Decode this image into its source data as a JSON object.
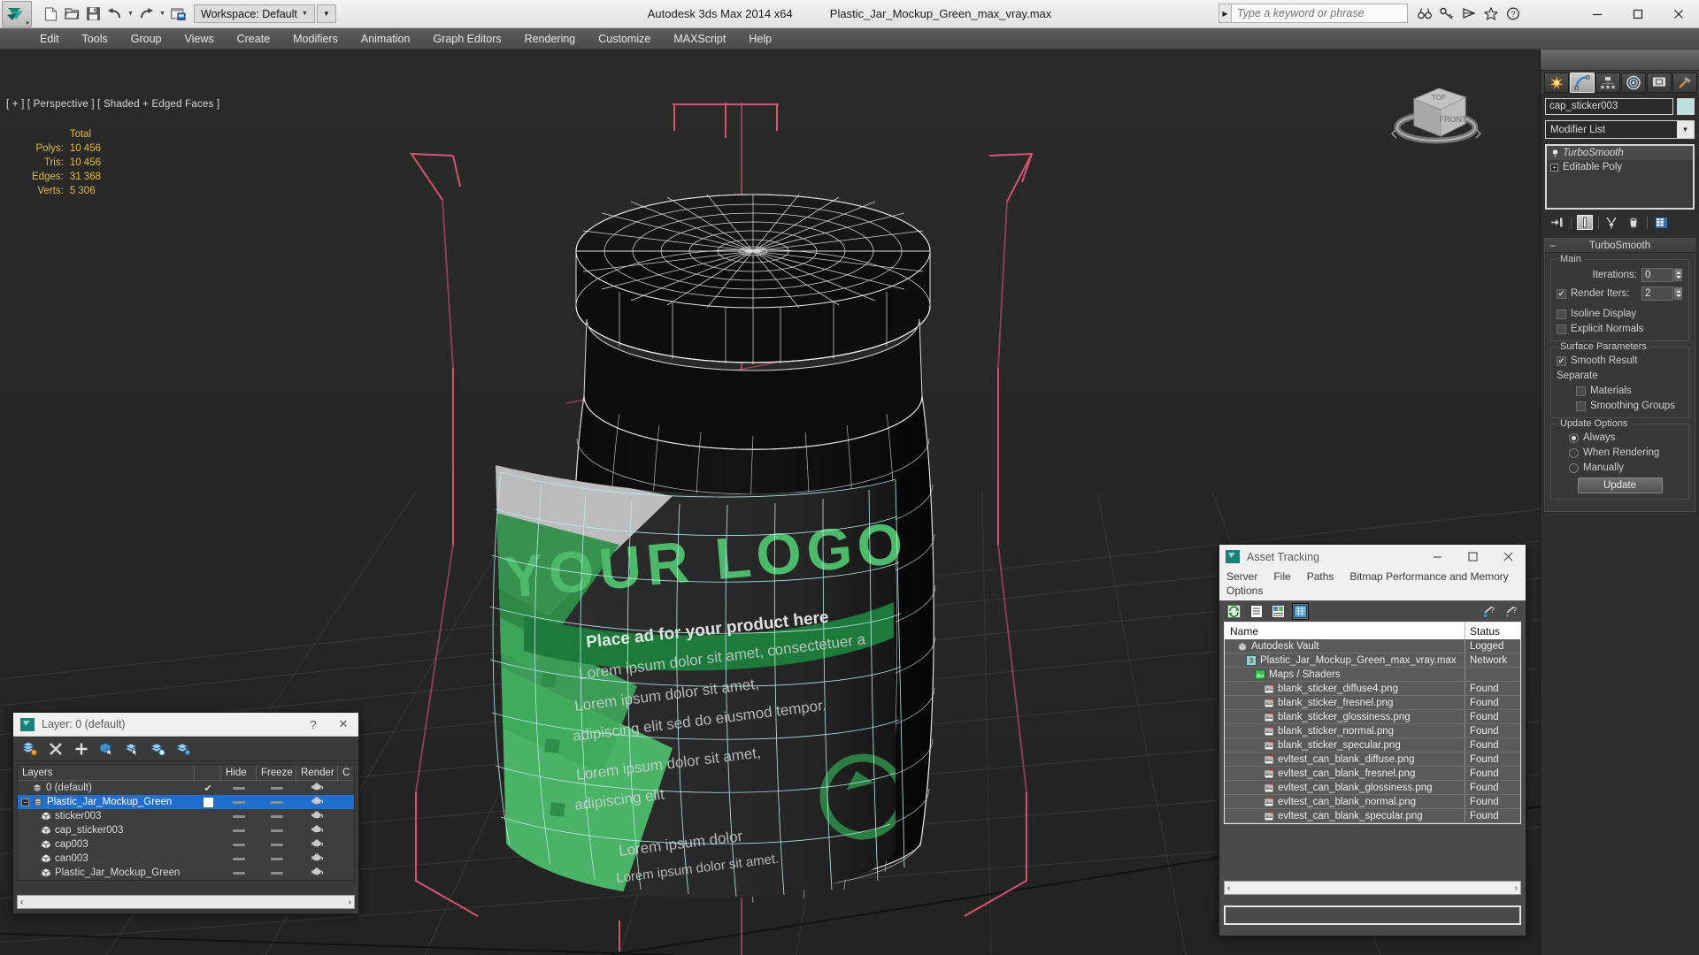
{
  "window": {
    "app_title": "Autodesk 3ds Max  2014 x64",
    "file_title": "Plastic_Jar_Mockup_Green_max_vray.max",
    "workspace_label": "Workspace: Default",
    "search_placeholder": "Type a keyword or phrase",
    "minimize": "—",
    "maximize": "☐",
    "close": "✕"
  },
  "menu": {
    "items": [
      "Edit",
      "Tools",
      "Group",
      "Views",
      "Create",
      "Modifiers",
      "Animation",
      "Graph Editors",
      "Rendering",
      "Customize",
      "MAXScript",
      "Help"
    ]
  },
  "viewport": {
    "label": "[ + ] [ Perspective ] [ Shaded + Edged Faces ]",
    "stats": {
      "column_header": "Total",
      "rows": [
        {
          "label": "Polys:",
          "value": "10 456"
        },
        {
          "label": "Tris:",
          "value": "10 456"
        },
        {
          "label": "Edges:",
          "value": "31 368"
        },
        {
          "label": "Verts:",
          "value": "5 306"
        }
      ]
    },
    "viewcube": {
      "top": "TOP",
      "front": "FRONT"
    },
    "model_label": {
      "logo": "YOUR LOGO",
      "tagline": "Place ad for your product here",
      "body_lines": [
        "Lorem ipsum dolor sit amet, consectetuer a",
        "Lorem ipsum dolor sit amet,",
        "adipiscing elit sed do eiusmod tempor.",
        "Lorem ipsum dolor sit amet,",
        "adipiscing elit",
        "Lorem ipsum dolor",
        "Lorem ipsum dolor sit amet."
      ]
    }
  },
  "command_panel": {
    "tabs": [
      "create-tab",
      "modify-tab",
      "hierarchy-tab",
      "motion-tab",
      "display-tab",
      "utilities-tab"
    ],
    "selected_tab_index": 1,
    "object_name": "cap_sticker003",
    "object_color": "#bfe0e0",
    "modifier_list_label": "Modifier List",
    "stack": [
      {
        "label": "TurboSmooth",
        "active": true
      },
      {
        "label": "Editable Poly",
        "active": false
      }
    ],
    "rollout": {
      "title": "TurboSmooth",
      "groups": {
        "main": {
          "title": "Main",
          "iterations_label": "Iterations:",
          "iterations_value": "0",
          "render_iters_label": "Render Iters:",
          "render_iters_value": "2",
          "render_iters_checked": true,
          "isoline_label": "Isoline Display",
          "isoline_checked": false,
          "explicit_label": "Explicit Normals",
          "explicit_checked": false
        },
        "surface": {
          "title": "Surface Parameters",
          "smooth_result_label": "Smooth Result",
          "smooth_result_checked": true,
          "separate_label": "Separate",
          "materials_label": "Materials",
          "materials_checked": false,
          "smoothing_groups_label": "Smoothing Groups",
          "smoothing_groups_checked": false
        },
        "update": {
          "title": "Update Options",
          "options": [
            "Always",
            "When Rendering",
            "Manually"
          ],
          "selected": 0,
          "button_label": "Update"
        }
      }
    }
  },
  "layer_dialog": {
    "title": "Layer: 0 (default)",
    "help_btn": "?",
    "close_btn": "✕",
    "columns": [
      "Layers",
      "",
      "Hide",
      "Freeze",
      "Render",
      "C"
    ],
    "rows": [
      {
        "name": "0 (default)",
        "indent": 1,
        "icon": "layer-icon",
        "selected": false,
        "mark": "check"
      },
      {
        "name": "Plastic_Jar_Mockup_Green",
        "indent": 0,
        "icon": "layer-icon",
        "selected": true,
        "mark": "box",
        "expander": "−"
      },
      {
        "name": "sticker003",
        "indent": 2,
        "icon": "object-icon",
        "selected": false,
        "mark": ""
      },
      {
        "name": "cap_sticker003",
        "indent": 2,
        "icon": "object-icon",
        "selected": false,
        "mark": ""
      },
      {
        "name": "cap003",
        "indent": 2,
        "icon": "object-icon",
        "selected": false,
        "mark": ""
      },
      {
        "name": "can003",
        "indent": 2,
        "icon": "object-icon",
        "selected": false,
        "mark": ""
      },
      {
        "name": "Plastic_Jar_Mockup_Green",
        "indent": 2,
        "icon": "object-icon",
        "selected": false,
        "mark": ""
      }
    ],
    "scroll_left": "‹",
    "scroll_right": "›"
  },
  "asset_tracking": {
    "title": "Asset Tracking",
    "menu": [
      "Server",
      "File",
      "Paths",
      "Bitmap Performance and Memory",
      "Options"
    ],
    "columns": {
      "name": "Name",
      "status": "Status"
    },
    "rows": [
      {
        "name": "Autodesk Vault",
        "status": "Logged",
        "indent": 1,
        "icon": "vault-icon"
      },
      {
        "name": "Plastic_Jar_Mockup_Green_max_vray.max",
        "status": "Network",
        "indent": 2,
        "icon": "max-file-icon"
      },
      {
        "name": "Maps / Shaders",
        "status": "",
        "indent": 3,
        "icon": "maps-icon"
      },
      {
        "name": "blank_sticker_diffuse4.png",
        "status": "Found",
        "indent": 4,
        "icon": "bitmap-icon"
      },
      {
        "name": "blank_sticker_fresnel.png",
        "status": "Found",
        "indent": 4,
        "icon": "bitmap-icon"
      },
      {
        "name": "blank_sticker_glossiness.png",
        "status": "Found",
        "indent": 4,
        "icon": "bitmap-icon"
      },
      {
        "name": "blank_sticker_normal.png",
        "status": "Found",
        "indent": 4,
        "icon": "bitmap-icon"
      },
      {
        "name": "blank_sticker_specular.png",
        "status": "Found",
        "indent": 4,
        "icon": "bitmap-icon"
      },
      {
        "name": "evltest_can_blank_diffuse.png",
        "status": "Found",
        "indent": 4,
        "icon": "bitmap-icon"
      },
      {
        "name": "evltest_can_blank_fresnel.png",
        "status": "Found",
        "indent": 4,
        "icon": "bitmap-icon"
      },
      {
        "name": "evltest_can_blank_glossiness.png",
        "status": "Found",
        "indent": 4,
        "icon": "bitmap-icon"
      },
      {
        "name": "evltest_can_blank_normal.png",
        "status": "Found",
        "indent": 4,
        "icon": "bitmap-icon"
      },
      {
        "name": "evltest_can_blank_specular.png",
        "status": "Found",
        "indent": 4,
        "icon": "bitmap-icon"
      }
    ],
    "scroll_left": "‹",
    "scroll_right": "›",
    "status_text": ""
  },
  "colors": {
    "accent_green": "#3fa85c",
    "label_green": "#4caf50",
    "selection_blue": "#1f6fd0",
    "stat_yellow": "#e0bb3c",
    "wire_cyan": "#b9ece8",
    "gizmo_pink": "#e0557a"
  }
}
